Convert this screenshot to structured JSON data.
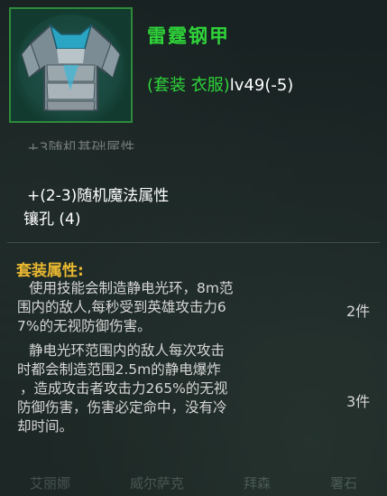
{
  "item": {
    "name": "雷霆钢甲",
    "type_prefix": "(套装 衣服)",
    "level": "lv49(-5)",
    "icon": "armor-chestplate-icon"
  },
  "attributes": {
    "faded_line": "+3随机基础属性",
    "magic": "+(2-3)随机魔法属性",
    "sockets": "镶孔 (4)"
  },
  "set": {
    "title": "套装属性:",
    "bonuses": [
      {
        "lines": [
          "使用技能会制造静电光环，8m范",
          "围内的敌人,每秒受到英雄攻击力6",
          "7%的无视防御伤害。"
        ],
        "pieces": "2件"
      },
      {
        "lines": [
          "静电光环范围内的敌人每次攻击",
          "时都会制造范围2.5m的静电爆炸",
          "，造成攻击者攻击力265%的无视",
          "防御伤害，伤害必定命中，没有冷",
          "却时间。"
        ],
        "pieces": "3件"
      }
    ]
  },
  "bottom_tabs": [
    "艾丽娜",
    "威尔萨克",
    "拜森",
    "署石"
  ],
  "colors": {
    "name_green": "#2fd43a",
    "set_gold": "#e8b830",
    "frame_green": "#2e8a3a"
  }
}
